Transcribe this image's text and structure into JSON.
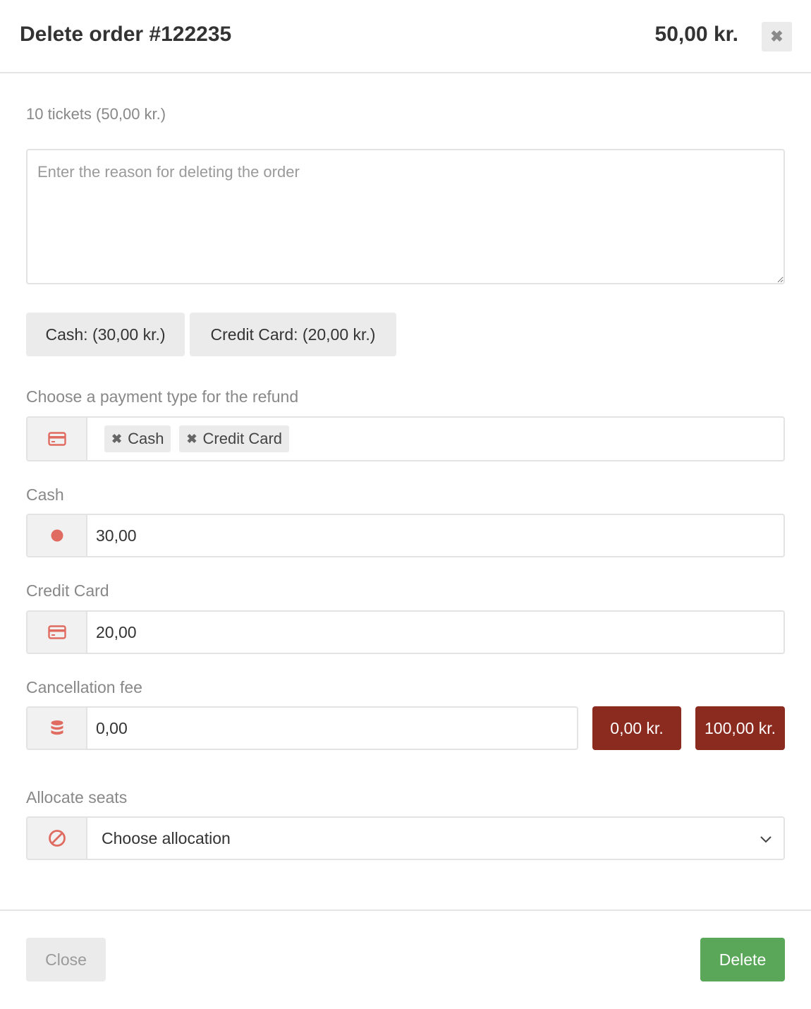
{
  "header": {
    "title": "Delete order #122235",
    "total": "50,00 kr.",
    "close_glyph": "✖"
  },
  "summary": "10 tickets (50,00 kr.)",
  "reason": {
    "placeholder": "Enter the reason for deleting the order",
    "value": ""
  },
  "payments": {
    "cash_label": "Cash: (30,00 kr.)",
    "credit_card_label": "Credit Card: (20,00 kr.)"
  },
  "refund_type": {
    "label": "Choose a payment type for the refund",
    "icon": "credit-card-icon",
    "tags": [
      {
        "label": "Cash",
        "remove_glyph": "✖"
      },
      {
        "label": "Credit Card",
        "remove_glyph": "✖"
      }
    ]
  },
  "cash": {
    "label": "Cash",
    "icon": "circle-icon",
    "value": "30,00"
  },
  "credit_card": {
    "label": "Credit Card",
    "icon": "credit-card-icon",
    "value": "20,00"
  },
  "cancellation_fee": {
    "label": "Cancellation fee",
    "icon": "database-icon",
    "value": "0,00",
    "presets": [
      "0,00 kr.",
      "100,00 kr."
    ]
  },
  "allocate_seats": {
    "label": "Allocate seats",
    "icon": "ban-icon",
    "selected": "Choose allocation"
  },
  "footer": {
    "close_label": "Close",
    "delete_label": "Delete"
  },
  "colors": {
    "icon_red": "#e06b60",
    "fee_button": "#8b2a1f",
    "delete_button": "#5aa75a"
  }
}
